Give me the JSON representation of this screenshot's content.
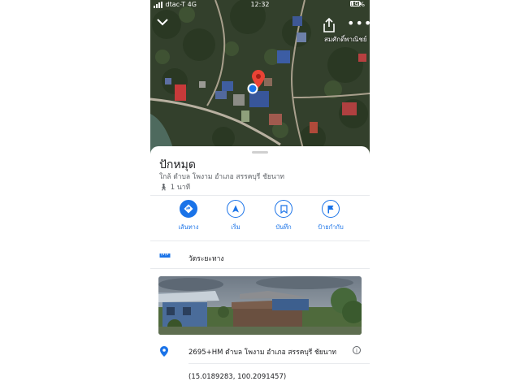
{
  "status_bar": {
    "carrier": "dtac-T 4G",
    "time": "12:32",
    "battery": "19%"
  },
  "map": {
    "label": "สมศักดิ์พาณิชย์",
    "colors": {
      "pin": "#ea4335",
      "location_dot": "#1a73e8"
    }
  },
  "place": {
    "title": "ปักหมุด",
    "subtitle": "ใกล้ ตำบล โพงาม อำเภอ สรรคบุรี ชัยนาท",
    "walk_time": "1 นาที"
  },
  "actions": [
    {
      "label": "เส้นทาง",
      "icon": "directions-icon"
    },
    {
      "label": "เริ่ม",
      "icon": "navigation-icon"
    },
    {
      "label": "บันทึก",
      "icon": "bookmark-icon"
    },
    {
      "label": "ป้ายกำกับ",
      "icon": "flag-icon"
    }
  ],
  "measure": {
    "label": "วัดระยะทาง"
  },
  "address": {
    "plus_code": "2695+HM ตำบล โพงาม อำเภอ สรรคบุรี ชัยนาท"
  },
  "coordinates": "(15.0189283, 100.2091457)",
  "theme": {
    "accent": "#1a73e8",
    "text": "#202124",
    "secondary": "#5f6368"
  }
}
